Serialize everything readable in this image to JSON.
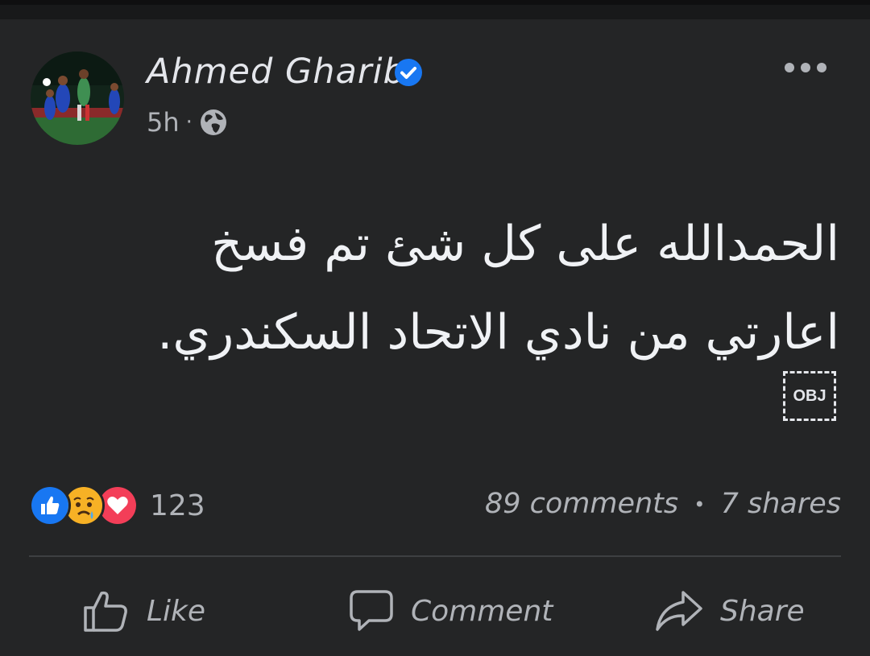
{
  "post": {
    "author": "Ahmed Gharib",
    "time": "5h",
    "separator": "·",
    "text_line1": "الحمدالله على كل شئ تم فسخ",
    "text_line2": "اعارتي من نادي الاتحاد السكندري.",
    "obj_label": "OBJ"
  },
  "engagement": {
    "reactions": [
      "like-icon",
      "sad-icon",
      "love-icon"
    ],
    "reaction_count": "123",
    "comments": "89 comments",
    "bullet": "•",
    "shares": "7 shares"
  },
  "actions": {
    "like": "Like",
    "comment": "Comment",
    "share": "Share"
  },
  "colors": {
    "background": "#242526",
    "text_primary": "#e4e6eb",
    "text_secondary": "#b0b3b8",
    "verified": "#1877f2",
    "like": "#1877f2",
    "love": "#f33e58",
    "sad": "#f7b125"
  }
}
